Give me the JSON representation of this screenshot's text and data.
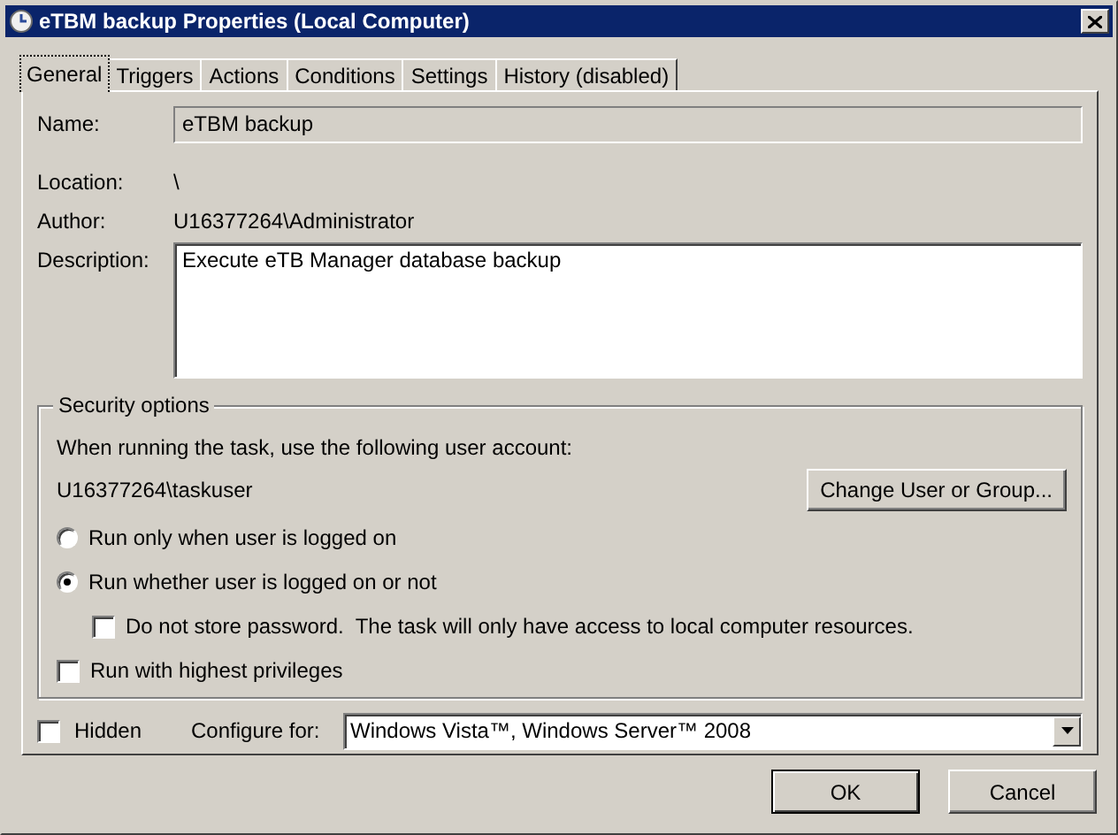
{
  "window": {
    "title": "eTBM backup Properties (Local Computer)"
  },
  "tabs": [
    {
      "label": "General",
      "selected": true
    },
    {
      "label": "Triggers",
      "selected": false
    },
    {
      "label": "Actions",
      "selected": false
    },
    {
      "label": "Conditions",
      "selected": false
    },
    {
      "label": "Settings",
      "selected": false
    },
    {
      "label": "History (disabled)",
      "selected": false
    }
  ],
  "fields": [
    {
      "label": "Name:",
      "kind": "input",
      "value": "eTBM backup",
      "editable": false
    },
    {
      "label": "Location:",
      "kind": "text",
      "value": "\\"
    },
    {
      "label": "Author:",
      "kind": "text",
      "value": "U16377264\\Administrator"
    },
    {
      "label": "Description:",
      "kind": "textarea",
      "value": "Execute eTB Manager database backup",
      "editable": true
    }
  ],
  "security": {
    "title": "Security options",
    "prompt": "When running the task, use the following user account:",
    "account": "U16377264\\taskuser",
    "change_button": "Change User or Group...",
    "options": [
      {
        "kind": "radio",
        "label": "Run only when user is logged on",
        "selected": false
      },
      {
        "kind": "radio",
        "label": "Run whether user is logged on or not",
        "selected": true,
        "children": [
          {
            "kind": "checkbox",
            "label": "Do not store password.  The task will only have access to local computer resources.",
            "checked": false
          }
        ]
      },
      {
        "kind": "checkbox",
        "label": "Run with highest privileges",
        "checked": false
      }
    ]
  },
  "hidden": {
    "label": "Hidden",
    "checked": false
  },
  "configure": {
    "label": "Configure for:",
    "value": "Windows Vista™, Windows Server™ 2008"
  },
  "buttons": [
    "OK",
    "Cancel"
  ]
}
